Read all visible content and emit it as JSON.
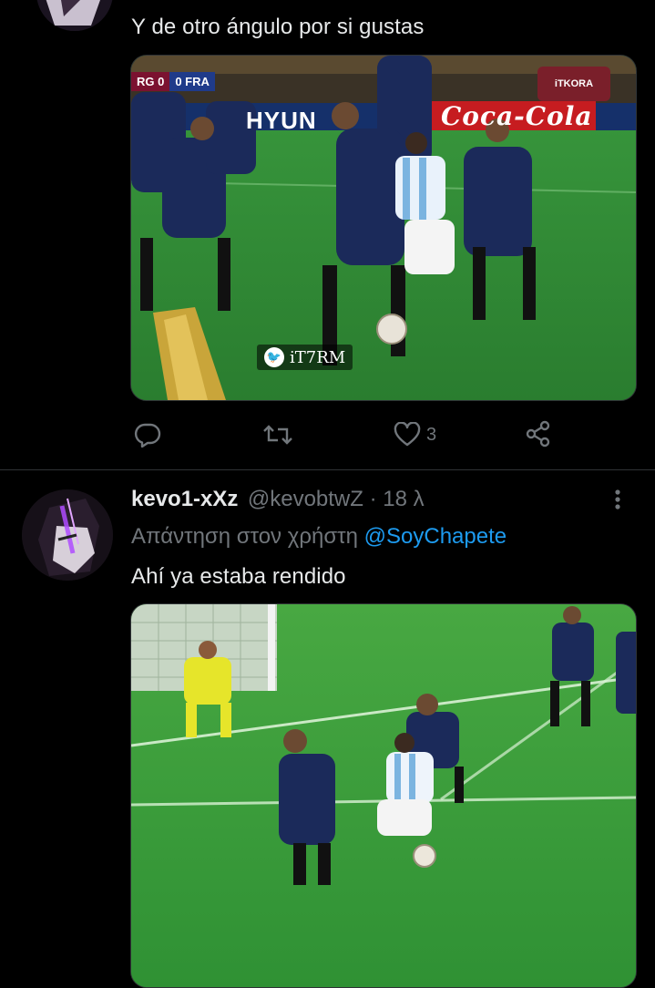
{
  "tweet1": {
    "text": "Y de otro ángulo por si gustas",
    "video": {
      "score_left": "RG 0",
      "score_right": "0 FRA",
      "broadcaster_logo": "iTKORA",
      "sponsor_1": "HYUN",
      "sponsor_2": "Coca-Cola",
      "watermark": "iT7RM"
    },
    "actions": {
      "reply_icon": "reply-icon",
      "retweet_icon": "retweet-icon",
      "like_icon": "heart-icon",
      "like_count": "3",
      "share_icon": "share-icon"
    }
  },
  "tweet2": {
    "display_name": "kevo1-xXz",
    "handle": "@kevobtwZ · 18 λ",
    "reply_prefix": "Απάντηση στον χρήστη ",
    "reply_to": "@SoyChapete",
    "text": "Ahí ya estaba rendido",
    "more_icon": "more-vertical-icon"
  },
  "colors": {
    "background": "#000000",
    "text": "#e7e9ea",
    "muted": "#71767b",
    "accent": "#1d9bf0",
    "pitch": "#2f8a35"
  }
}
